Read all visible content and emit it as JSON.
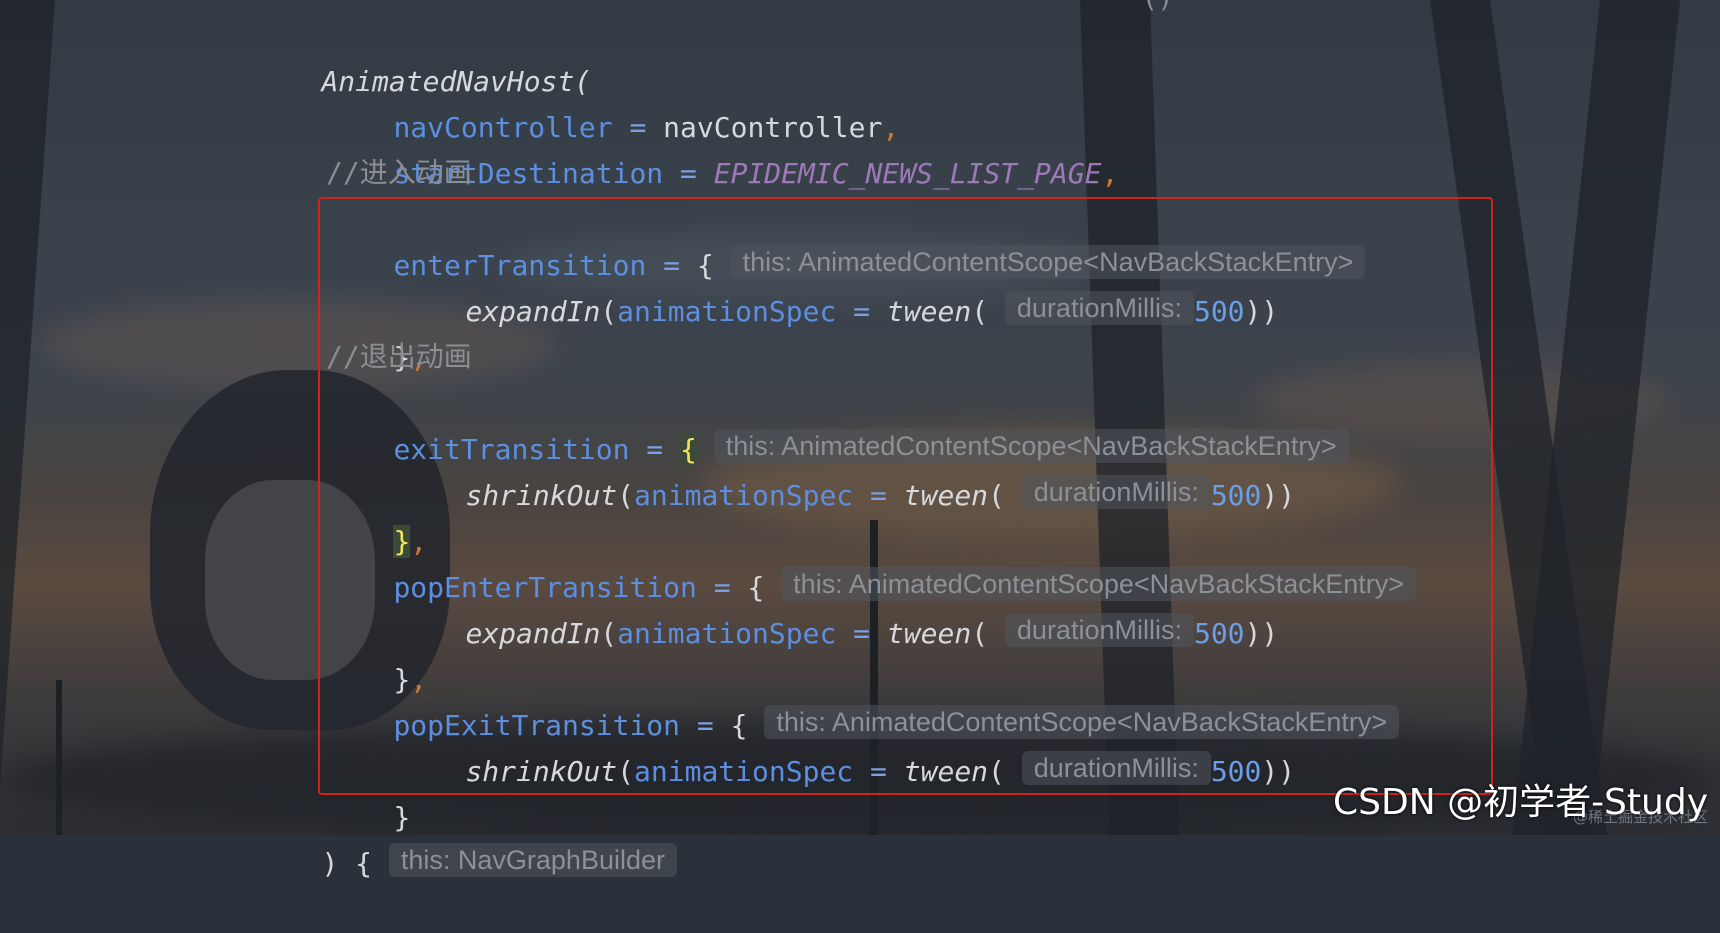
{
  "code": {
    "host_call": "AnimatedNavHost(",
    "nav_controller_param": "navController",
    "nav_controller_value": "navController",
    "start_destination_param": "startDestination",
    "start_destination_value": "EPIDEMIC_NEWS_LIST_PAGE",
    "comment_enter": "//进入动画",
    "comment_exit": "//退出动画",
    "enter_param": "enterTransition",
    "exit_param": "exitTransition",
    "pop_enter_param": "popEnterTransition",
    "pop_exit_param": "popExitTransition",
    "expand_fn": "expandIn",
    "shrink_fn": "shrinkOut",
    "animation_spec": "animationSpec",
    "tween_fn": "tween",
    "duration_value": "500",
    "scope_hint": "this: AnimatedContentScope<NavBackStackEntry>",
    "duration_hint": "durationMillis:",
    "builder_hint": "this: NavGraphBuilder",
    "top_fragment": "()"
  },
  "watermark": {
    "main": "CSDN @初学者-Study",
    "small": "@稀土掘金技术社区"
  },
  "colors": {
    "highlight_box": "#d0251f",
    "identifier": "#5d8fe0",
    "constant": "#9e78b8",
    "comment": "#8a8d92"
  }
}
